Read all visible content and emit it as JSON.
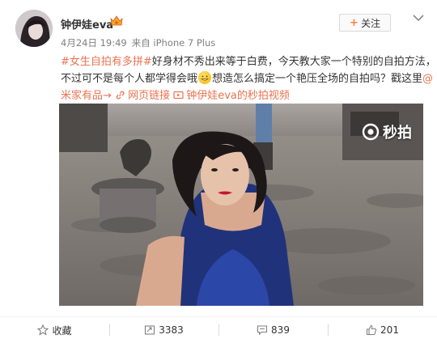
{
  "post": {
    "username": "钟伊娃eva",
    "follow_label": "关注",
    "date": "4月24日 19:49",
    "source_prefix": "来自",
    "source_device": "iPhone 7 Plus",
    "content": {
      "hashtag": "#女生自拍有多拼#",
      "text1": "好身材不秀出来等于白费，今天教大家一个特别的自拍方法，",
      "text2": "不过可不是每个人都学得会哦",
      "text3": "想造怎么搞定一个艳压全场的自拍吗？戳这里",
      "mention_at": "@",
      "mention_name": "米家有品",
      "arrow": "→",
      "web_link": "网页链接",
      "video_link": "钟伊娃eva的秒拍视频"
    },
    "video": {
      "watermark_text": "秒拍"
    }
  },
  "actions": {
    "favorite": "收藏",
    "repost_count": "3383",
    "comment_count": "839",
    "like_count": "201"
  },
  "colors": {
    "link": "#eb7350",
    "accent": "#ff8140",
    "meta": "#808080"
  },
  "icons": [
    "vip-crown-icon",
    "chevron-down-icon",
    "emoji-grin-icon",
    "link-icon",
    "video-link-icon",
    "miaopai-logo-icon",
    "star-icon",
    "repost-icon",
    "comment-icon",
    "thumbs-up-icon"
  ]
}
